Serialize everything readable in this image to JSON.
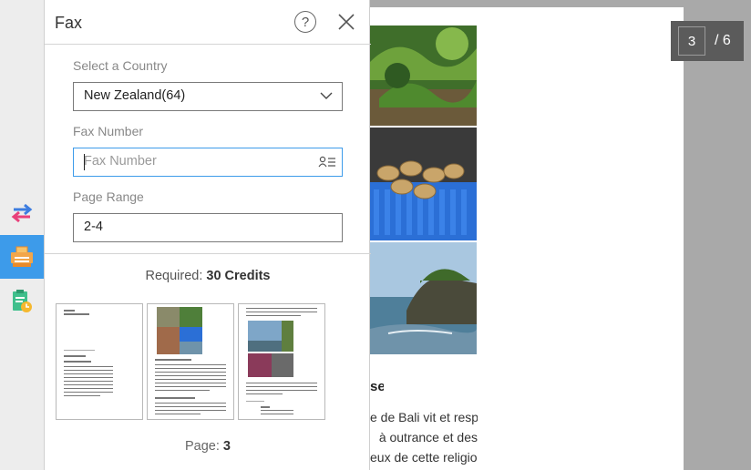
{
  "panel": {
    "title": "Fax",
    "help_icon": "question-circle-icon",
    "close_icon": "close-icon",
    "country": {
      "label": "Select a Country",
      "value": "New Zealand(64)"
    },
    "fax_number": {
      "label": "Fax Number",
      "placeholder": "Fax Number",
      "value": ""
    },
    "page_range": {
      "label": "Page Range",
      "value": "2-4"
    },
    "required": {
      "label": "Required:",
      "value": "30 Credits"
    },
    "thumbnails": [
      {
        "name": "page-2"
      },
      {
        "name": "page-3"
      },
      {
        "name": "page-4"
      }
    ],
    "page_indicator": {
      "label": "Page:",
      "value": "3"
    }
  },
  "sidebar": {
    "items": [
      {
        "name": "convert",
        "icon": "convert-arrows-icon",
        "active": false
      },
      {
        "name": "fax",
        "icon": "fax-icon",
        "active": true
      },
      {
        "name": "scheduled",
        "icon": "clipboard-clock-icon",
        "active": false
      }
    ]
  },
  "document": {
    "heading": "se",
    "lines": [
      "e de Bali vit et respire",
      "à outrance et des",
      "eux de cette religion"
    ],
    "current_page": "3",
    "page_total": "/ 6"
  },
  "colors": {
    "accent": "#3d9bea",
    "panel_bg": "#ffffff",
    "rail_bg": "#ededed"
  }
}
